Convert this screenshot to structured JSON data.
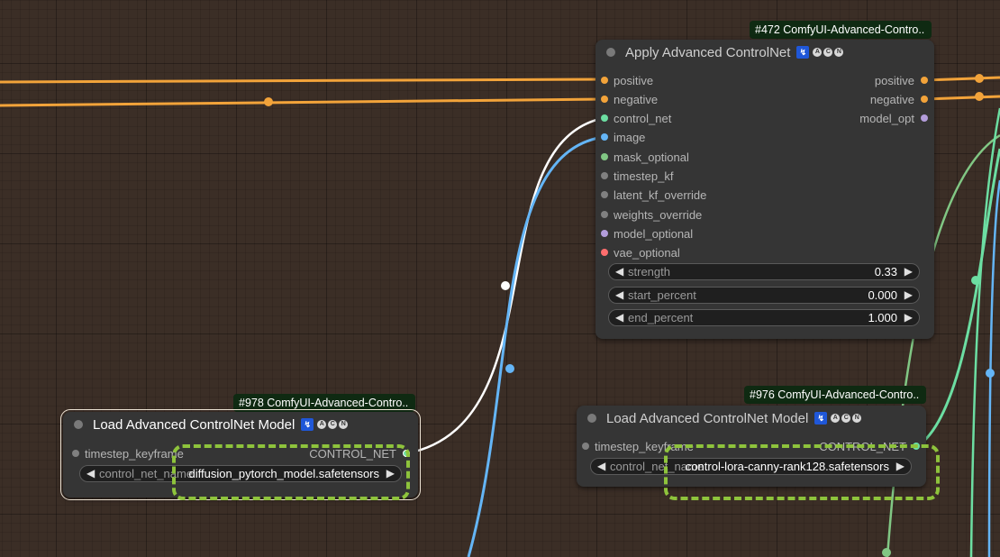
{
  "node_472": {
    "tag": "#472 ComfyUI-Advanced-Contro..",
    "title": "Apply Advanced ControlNet",
    "badge_box": "↯",
    "badges": [
      "A",
      "C",
      "N"
    ],
    "inputs": [
      "positive",
      "negative",
      "control_net",
      "image",
      "mask_optional",
      "timestep_kf",
      "latent_kf_override",
      "weights_override",
      "model_optional",
      "vae_optional"
    ],
    "outputs": [
      "positive",
      "negative",
      "model_opt"
    ],
    "widgets": [
      {
        "label": "strength",
        "value": "0.33"
      },
      {
        "label": "start_percent",
        "value": "0.000"
      },
      {
        "label": "end_percent",
        "value": "1.000"
      }
    ]
  },
  "node_978": {
    "tag": "#978 ComfyUI-Advanced-Contro..",
    "title": "Load Advanced ControlNet Model",
    "badge_box": "↯",
    "badges": [
      "A",
      "C",
      "N"
    ],
    "input": "timestep_keyframe",
    "output": "CONTROL_NET",
    "widget": {
      "label": "control_net_name",
      "value": "diffusion_pytorch_model.safetensors"
    }
  },
  "node_976": {
    "tag": "#976 ComfyUI-Advanced-Contro..",
    "title": "Load Advanced ControlNet Model",
    "badge_box": "↯",
    "badges": [
      "A",
      "C",
      "N"
    ],
    "input": "timestep_keyframe",
    "output": "CONTROL_NET",
    "widget": {
      "label": "control_net_name",
      "value": "control-lora-canny-rank128.safetensors"
    }
  },
  "colors": {
    "conditioning": "#f2a33a",
    "control_net": "#6cdea2",
    "image": "#64b5f6",
    "mask": "#81c784",
    "model": "#b39ddb",
    "vae": "#ff6e6e",
    "generic": "#808080",
    "highlight": "#8ec33c"
  }
}
